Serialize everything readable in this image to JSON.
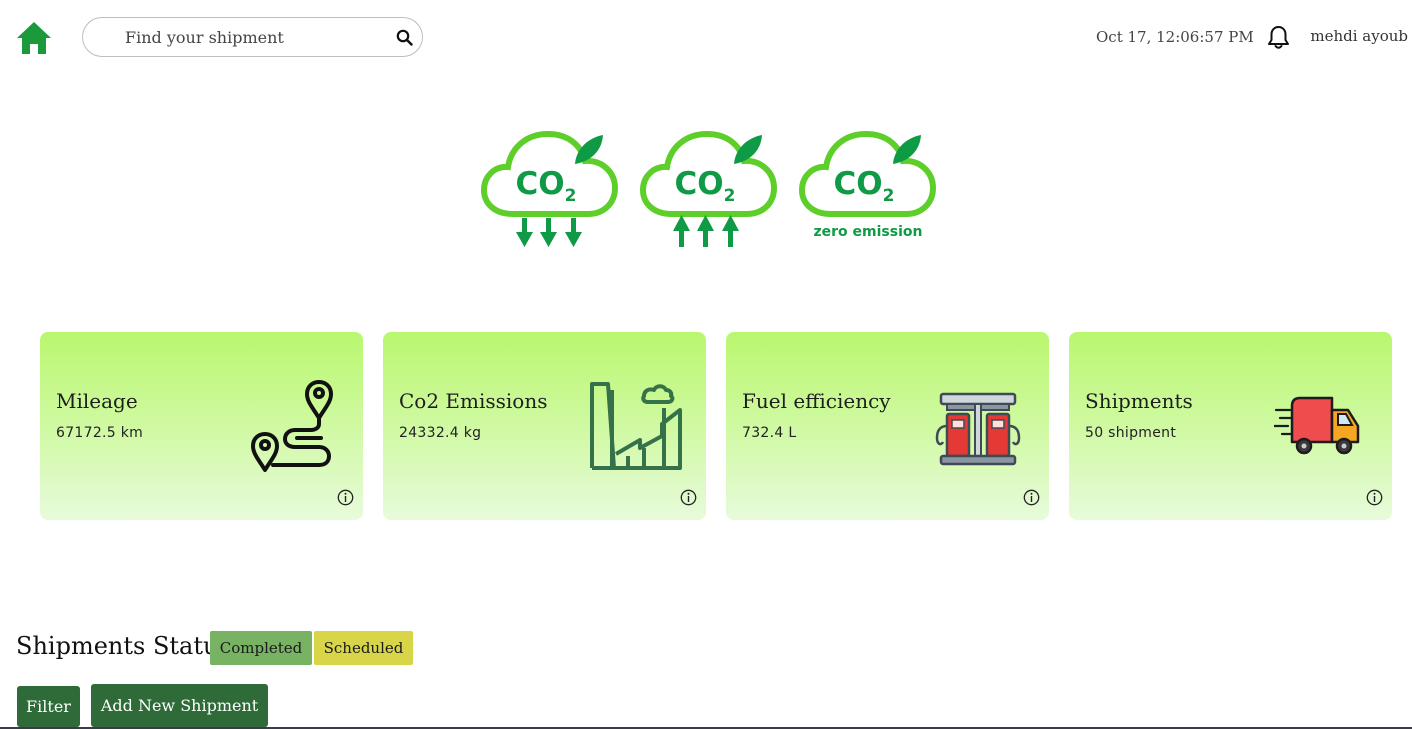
{
  "header": {
    "search": {
      "placeholder": "Find your shipment",
      "value": ""
    },
    "datetime": "Oct 17, 12:06:57 PM",
    "user_name": "mehdi ayoub",
    "icons": {
      "home": "home-icon",
      "search": "search-icon",
      "notifications": "bell-icon"
    }
  },
  "co2_badges": [
    {
      "label": "CO",
      "subscript": "2",
      "caption": "",
      "indicator": "down-arrows"
    },
    {
      "label": "CO",
      "subscript": "2",
      "caption": "",
      "indicator": "up-arrows"
    },
    {
      "label": "CO",
      "subscript": "2",
      "caption": "zero emission",
      "indicator": "none"
    }
  ],
  "cards": [
    {
      "title": "Mileage",
      "value": "67172.5 km",
      "icon": "route-icon"
    },
    {
      "title": "Co2 Emissions",
      "value": "24332.4 kg",
      "icon": "factory-icon"
    },
    {
      "title": "Fuel efficiency",
      "value": "732.4 L",
      "icon": "fuel-station-icon"
    },
    {
      "title": "Shipments",
      "value": "50 shipment",
      "icon": "delivery-truck-icon"
    }
  ],
  "status": {
    "title": "Shipments Status",
    "badges": {
      "completed": "Completed",
      "scheduled": "Scheduled"
    },
    "buttons": {
      "filter": "Filter",
      "add": "Add New Shipment"
    }
  },
  "colors": {
    "brand_green": "#2e6b39",
    "home_green": "#1a9a3a",
    "co2_green": "#5ecf2a",
    "co2_dark": "#0f9a45",
    "card_gradient_top": "#b9f76f",
    "card_gradient_bottom": "#e7fbdb",
    "completed": "#77b363",
    "scheduled": "#d8d648"
  }
}
